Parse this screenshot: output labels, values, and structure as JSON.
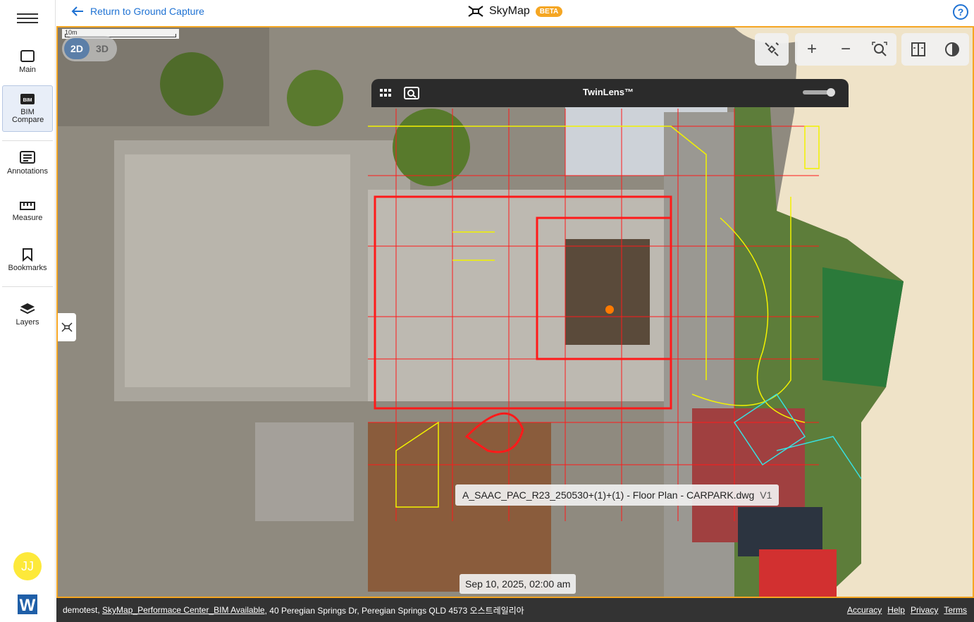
{
  "sidebar": {
    "items": [
      {
        "label": "Main",
        "icon": "square-icon"
      },
      {
        "label": "BIM Compare",
        "icon": "bim-icon",
        "icon_text": "BIM"
      },
      {
        "label": "Annotations",
        "icon": "annotations-icon"
      },
      {
        "label": "Measure",
        "icon": "ruler-icon"
      },
      {
        "label": "Bookmarks",
        "icon": "bookmark-icon"
      },
      {
        "label": "Layers",
        "icon": "layers-icon"
      }
    ],
    "avatar_initials": "JJ",
    "avatar_color": "#fde93a",
    "logo_letter": "W"
  },
  "header": {
    "back_label": "Return to Ground Capture",
    "app_name": "SkyMap",
    "badge": "BETA"
  },
  "map": {
    "scale_label": "10m",
    "dim_2d": "2D",
    "dim_3d": "3D",
    "twinlens_title": "TwinLens™",
    "opacity_level": 0.95,
    "drawing_name": "A_SAAC_PAC_R23_250530+(1)+(1) - Floor Plan - CARPARK.dwg",
    "drawing_version": "V1",
    "capture_date": "Sep 10, 2025, 02:00 am"
  },
  "footer": {
    "user": "demotest,",
    "project": "SkyMap_Performace Center_BIM Available",
    "address": ", 40 Peregian Springs Dr, Peregian Springs QLD 4573 오스트레일리아",
    "links": [
      "Accuracy",
      "Help",
      "Privacy",
      "Terms"
    ]
  },
  "colors": {
    "accent": "#f5a623",
    "link": "#1f72d3",
    "footer_bg": "#333333",
    "cad_red": "#ff1a1a",
    "cad_yellow": "#f2f200"
  }
}
